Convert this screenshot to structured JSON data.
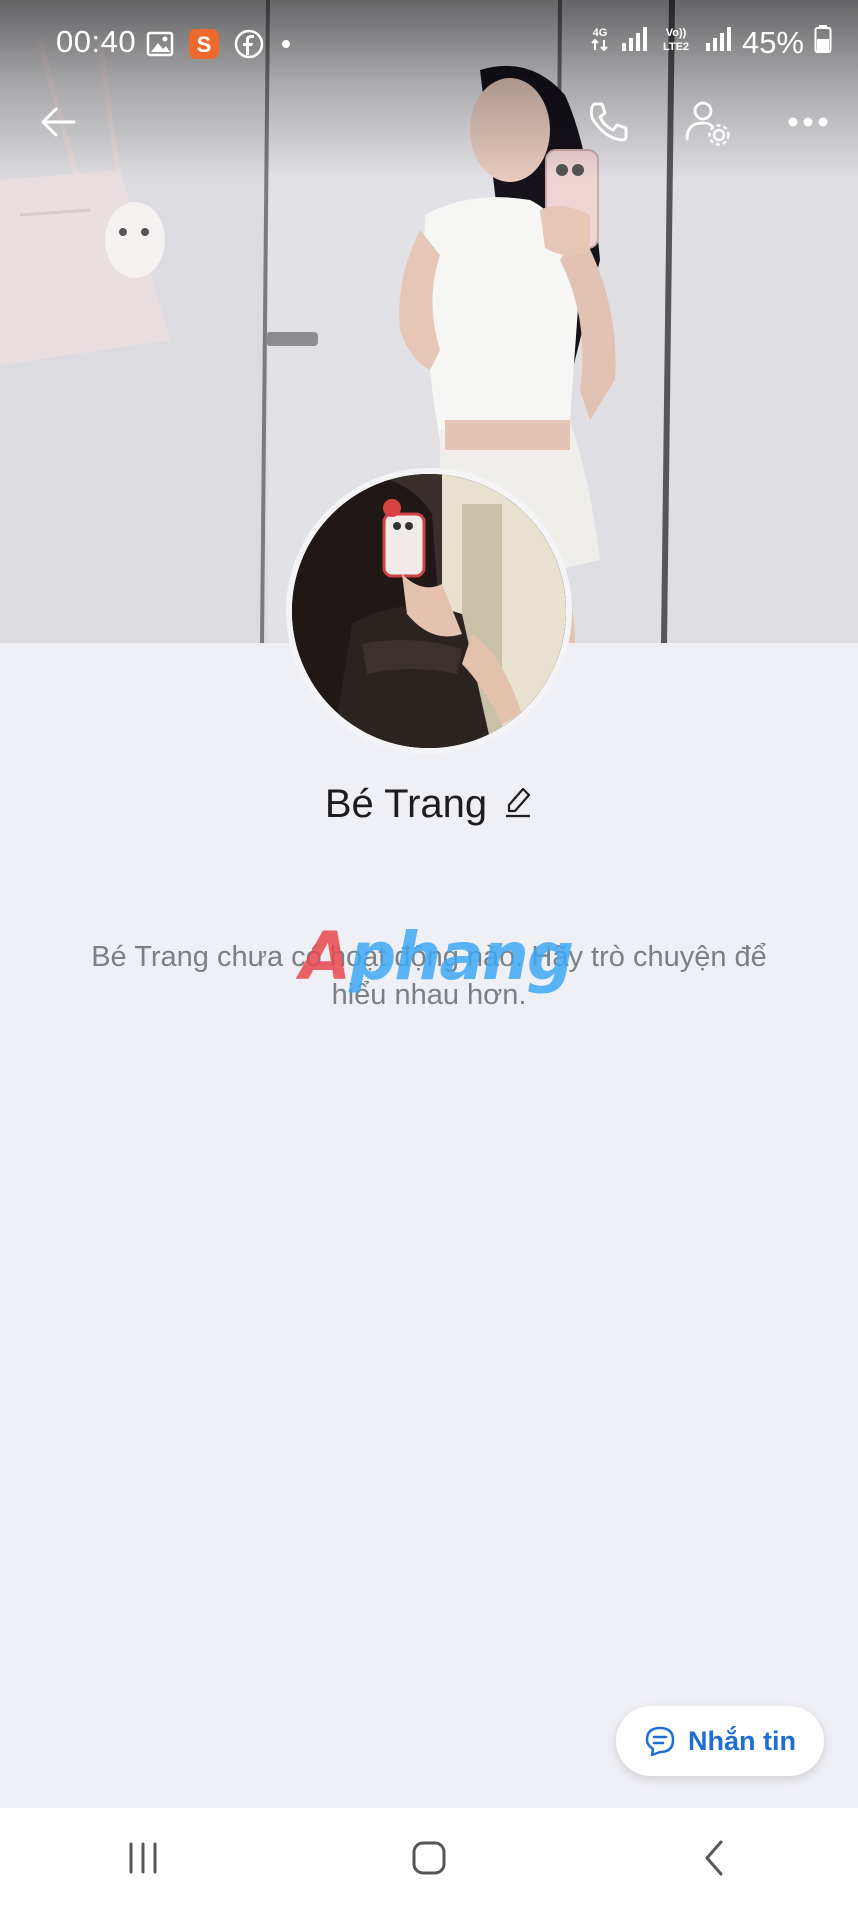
{
  "status_bar": {
    "time": "00:40",
    "battery": "45%",
    "network_1": "4G",
    "network_2": "VoLTE2",
    "left_icons": [
      "gallery-icon",
      "shopee-icon",
      "facebook-icon",
      "dot-icon"
    ]
  },
  "header": {
    "back": "back-arrow-icon",
    "call": "phone-icon",
    "settings": "user-settings-icon",
    "more": "more-icon"
  },
  "profile": {
    "name": "Bé Trang",
    "edit_icon": "pencil-icon",
    "empty_message": "Bé Trang chưa có hoạt động nào. Hãy trò chuyện để hiểu nhau hơn."
  },
  "watermark": {
    "a": "A",
    "rest": "phang"
  },
  "actions": {
    "message_label": "Nhắn tin",
    "message_icon": "chat-bubble-icon"
  },
  "nav": {
    "recents": "recents-icon",
    "home": "home-icon",
    "back": "back-icon"
  },
  "colors": {
    "accent": "#1f6ed4",
    "background": "#eff0f5",
    "text_muted": "#7b7f86"
  }
}
